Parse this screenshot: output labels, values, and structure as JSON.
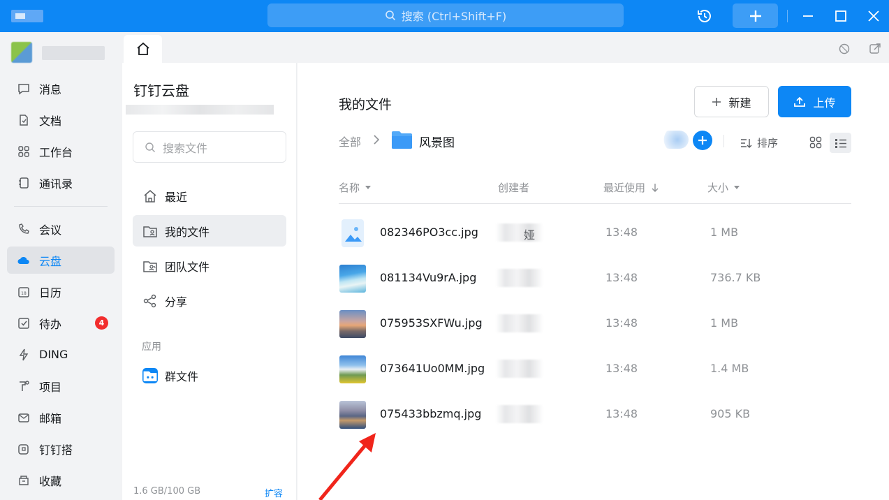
{
  "titlebar": {
    "search_placeholder": "搜索 (Ctrl+Shift+F)"
  },
  "leftnav": {
    "items": [
      {
        "label": "消息",
        "icon": "message-icon"
      },
      {
        "label": "文档",
        "icon": "document-icon"
      },
      {
        "label": "工作台",
        "icon": "workbench-icon"
      },
      {
        "label": "通讯录",
        "icon": "contacts-icon"
      },
      {
        "label": "会议",
        "icon": "meeting-icon"
      },
      {
        "label": "云盘",
        "icon": "cloud-icon"
      },
      {
        "label": "日历",
        "icon": "calendar-icon"
      },
      {
        "label": "待办",
        "icon": "todo-icon",
        "badge": "4"
      },
      {
        "label": "DING",
        "icon": "ding-icon"
      },
      {
        "label": "项目",
        "icon": "project-icon"
      },
      {
        "label": "邮箱",
        "icon": "mail-icon"
      },
      {
        "label": "钉钉搭",
        "icon": "dingda-icon"
      },
      {
        "label": "收藏",
        "icon": "favorites-icon"
      }
    ],
    "active": "云盘"
  },
  "midpanel": {
    "title": "钉钉云盘",
    "search_placeholder": "搜索文件",
    "items": [
      {
        "label": "最近"
      },
      {
        "label": "我的文件"
      },
      {
        "label": "团队文件"
      },
      {
        "label": "分享"
      }
    ],
    "section_label": "应用",
    "group_files_label": "群文件",
    "storage": "1.6 GB/100 GB",
    "expand_label": "扩容"
  },
  "main": {
    "title": "我的文件",
    "new_button": "新建",
    "upload_button": "上传",
    "breadcrumb_root": "全部",
    "breadcrumb_folder": "风景图",
    "sort_label": "排序",
    "columns": {
      "name": "名称",
      "creator": "创建者",
      "recent": "最近使用",
      "size": "大小"
    },
    "files": [
      {
        "name": "082346PO3cc.jpg",
        "creator_partial": "娅",
        "time": "13:48",
        "size": "1 MB"
      },
      {
        "name": "081134Vu9rA.jpg",
        "creator_partial": "",
        "time": "13:48",
        "size": "736.7 KB"
      },
      {
        "name": "075953SXFWu.jpg",
        "creator_partial": "",
        "time": "13:48",
        "size": "1 MB"
      },
      {
        "name": "073641Uo0MM.jpg",
        "creator_partial": "",
        "time": "13:48",
        "size": "1.4 MB"
      },
      {
        "name": "075433bbzmq.jpg",
        "creator_partial": "",
        "time": "13:48",
        "size": "905 KB"
      }
    ]
  },
  "colors": {
    "brand_blue": "#0d87f5",
    "badge_red": "#f22d2d",
    "annotation_arrow": "#f0251b"
  }
}
